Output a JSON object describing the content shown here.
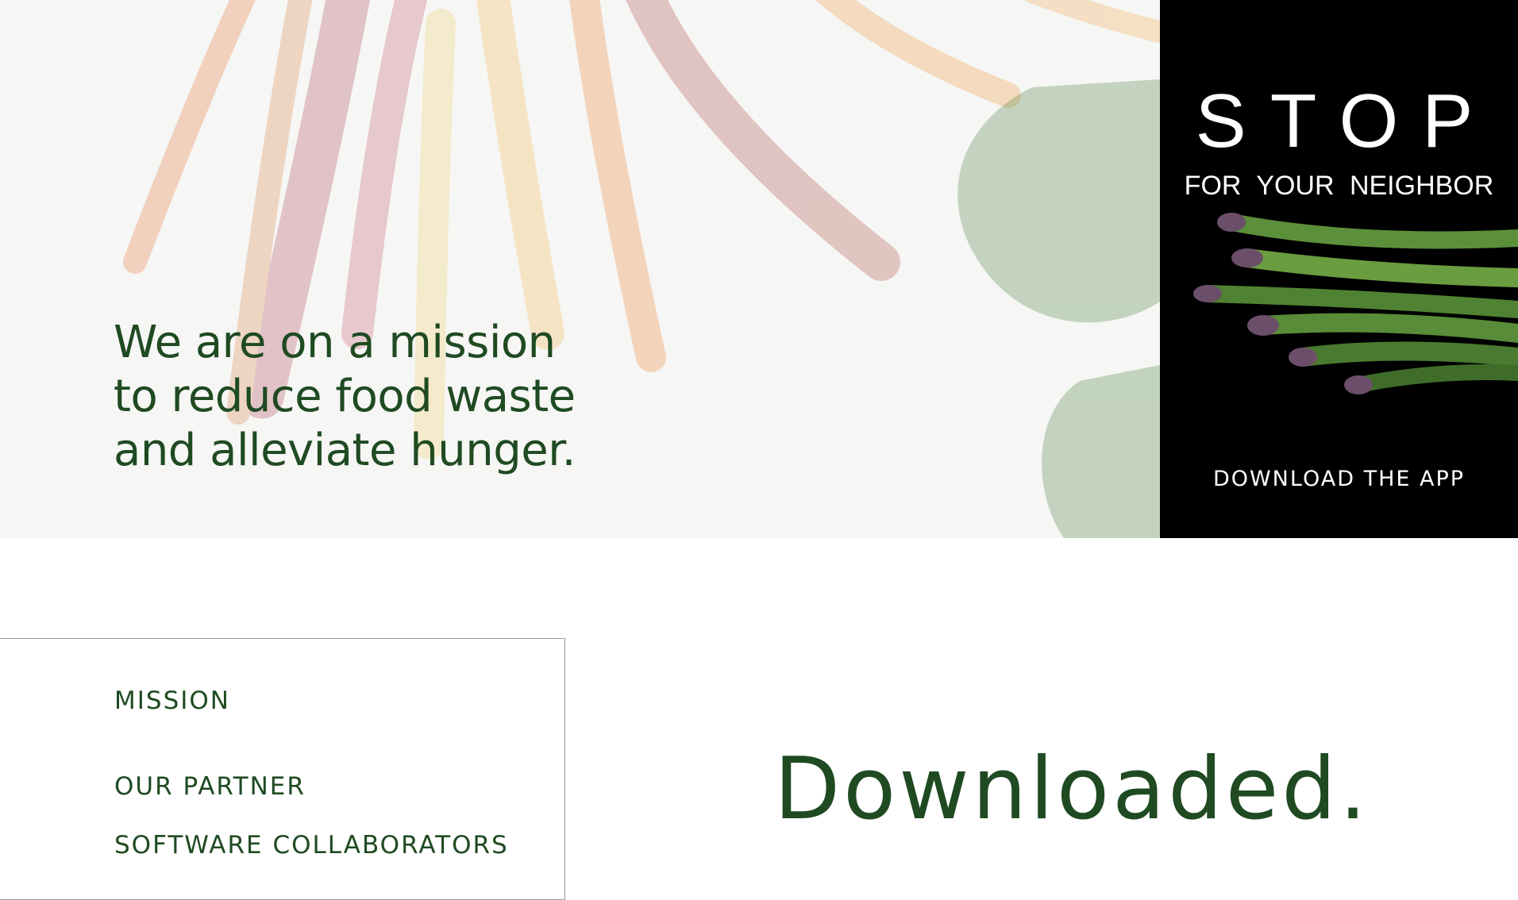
{
  "hero": {
    "headline_lines": [
      "We are on a mission",
      "to reduce food waste",
      "and alleviate hunger."
    ],
    "background_image": "faded carrots and leafy greens",
    "text_color": "#1f4a22"
  },
  "ad": {
    "title": "STOP",
    "subtitle": "FOR YOUR NEIGHBOR",
    "image": "asparagus bundle",
    "cta": "DOWNLOAD THE APP",
    "background_color": "#000000"
  },
  "nav": {
    "items": [
      {
        "label": "MISSION"
      },
      {
        "label": "OUR PARTNER"
      },
      {
        "label": "SOFTWARE COLLABORATORS"
      }
    ]
  },
  "main": {
    "status_text": "Downloaded."
  }
}
